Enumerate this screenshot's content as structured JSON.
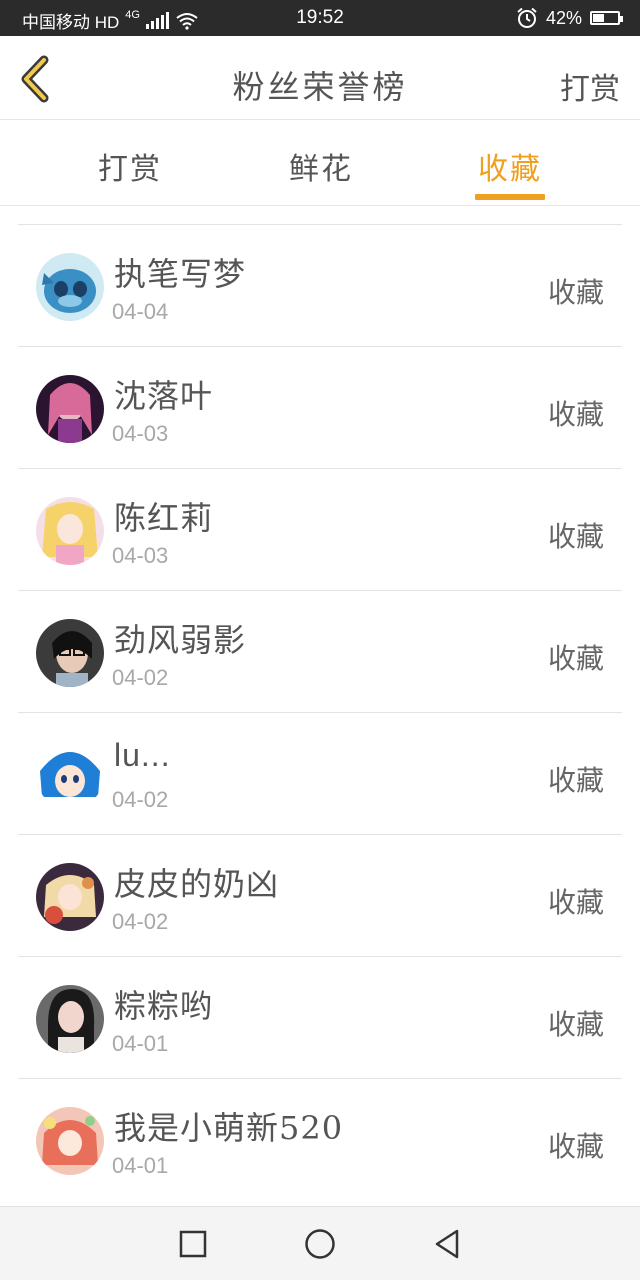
{
  "status_bar": {
    "carrier": "中国移动 HD",
    "network": "4G",
    "time": "19:52",
    "battery": "42%"
  },
  "header": {
    "title": "粉丝荣誉榜",
    "action_label": "打赏"
  },
  "tabs": [
    {
      "label": "打赏",
      "active": false
    },
    {
      "label": "鲜花",
      "active": false
    },
    {
      "label": "收藏",
      "active": true
    }
  ],
  "entries": [
    {
      "name": "执笔写梦",
      "date": "04-04",
      "action": "收藏"
    },
    {
      "name": "沈落叶",
      "date": "04-03",
      "action": "收藏"
    },
    {
      "name": "陈红莉",
      "date": "04-03",
      "action": "收藏"
    },
    {
      "name": "劲风弱影",
      "date": "04-02",
      "action": "收藏"
    },
    {
      "name": "lu...",
      "date": "04-02",
      "action": "收藏"
    },
    {
      "name": "皮皮的奶凶",
      "date": "04-02",
      "action": "收藏"
    },
    {
      "name": "粽粽哟",
      "date": "04-01",
      "action": "收藏"
    },
    {
      "name": "我是小萌新520",
      "date": "04-01",
      "action": "收藏"
    }
  ],
  "colors": {
    "accent": "#f0a020",
    "text": "#555555",
    "date_text": "#a8a8a8",
    "status_bar_bg": "#2b2b2b"
  },
  "icons": {
    "back": "chevron-left-icon",
    "nav_recents": "square-icon",
    "nav_home": "circle-icon",
    "nav_back": "triangle-back-icon"
  }
}
